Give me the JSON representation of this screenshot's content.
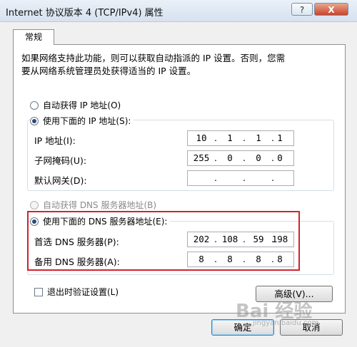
{
  "window": {
    "title": "Internet 协议版本 4 (TCP/IPv4) 属性",
    "help_label": "?",
    "close_label": "X"
  },
  "tab": {
    "label": "常规"
  },
  "description": {
    "line1": "如果网络支持此功能，则可以获取自动指派的 IP 设置。否则，您需",
    "line2": "要从网络系统管理员处获得适当的 IP 设置。"
  },
  "ip_mode": {
    "auto_label": "自动获得 IP 地址(O)",
    "manual_label": "使用下面的 IP 地址(S):",
    "selected": "manual"
  },
  "ip_fields": [
    {
      "label": "IP 地址(I):",
      "octets": [
        "10",
        "1",
        "1",
        "1"
      ]
    },
    {
      "label": "子网掩码(U):",
      "octets": [
        "255",
        "0",
        "0",
        "0"
      ]
    },
    {
      "label": "默认网关(D):",
      "octets": [
        "",
        "",
        "",
        ""
      ]
    }
  ],
  "dns_mode": {
    "auto_label": "自动获得 DNS 服务器地址(B)",
    "manual_label": "使用下面的 DNS 服务器地址(E):",
    "selected": "manual"
  },
  "dns_fields": [
    {
      "label": "首选 DNS 服务器(P):",
      "octets": [
        "202",
        "108",
        "59",
        "198"
      ]
    },
    {
      "label": "备用 DNS 服务器(A):",
      "octets": [
        "8",
        "8",
        "8",
        "8"
      ]
    }
  ],
  "validate_on_exit": {
    "label": "退出时验证设置(L)",
    "checked": false
  },
  "buttons": {
    "advanced": "高级(V)...",
    "ok": "确定",
    "cancel": "取消"
  },
  "watermark": {
    "main": "Bai 经验",
    "sub": "jingyan.baidu.com"
  },
  "colors": {
    "highlight": "#d0242e",
    "radio_dot": "#2b4a78"
  }
}
